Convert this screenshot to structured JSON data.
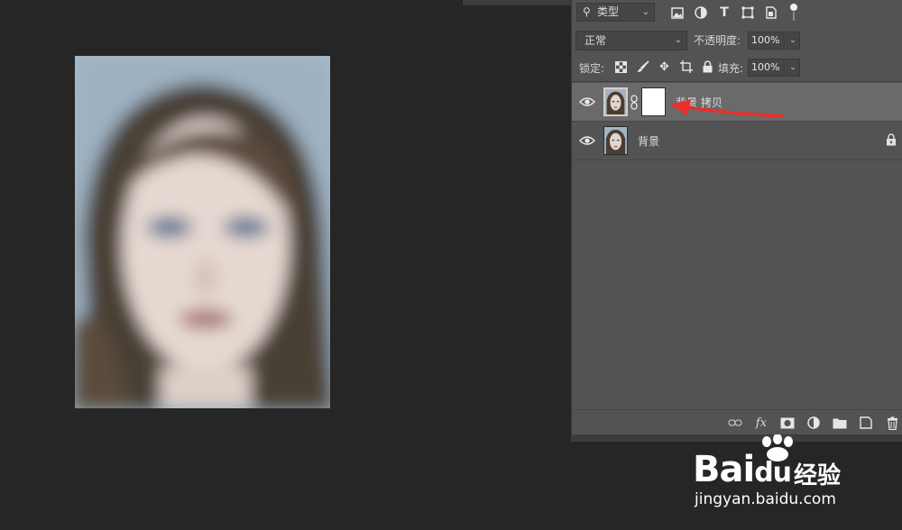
{
  "layers_panel": {
    "filter": {
      "label": "类型",
      "icon": "search-icon"
    },
    "filter_icons": [
      "image-filter-icon",
      "adjustment-filter-icon",
      "text-filter-icon",
      "shape-filter-icon",
      "smart-object-filter-icon"
    ],
    "blend_mode": "正常",
    "opacity_label": "不透明度:",
    "opacity_value": "100%",
    "lock_label": "锁定:",
    "lock_icons": [
      "lock-transparent-icon",
      "lock-brush-icon",
      "lock-move-icon",
      "lock-artboard-icon",
      "lock-all-icon"
    ],
    "fill_label": "填充:",
    "fill_value": "100%",
    "layers": [
      {
        "name": "背景 拷贝",
        "selected": true,
        "has_mask": true,
        "locked": false
      },
      {
        "name": "背景",
        "selected": false,
        "has_mask": false,
        "locked": true
      }
    ],
    "bottom_icons": [
      "link-icon",
      "fx-icon",
      "mask-icon",
      "adjustment-icon",
      "folder-icon",
      "new-layer-icon",
      "trash-icon"
    ],
    "fx_label": "fx"
  },
  "watermark": {
    "brand": "Bai",
    "brand_tail": "du",
    "cn": "经验",
    "url": "jingyan.baidu.com"
  },
  "colors": {
    "panel_bg": "#535353",
    "canvas_bg": "#262626",
    "selected_row": "#6a6a6a",
    "annotation_arrow": "#e8302c"
  }
}
